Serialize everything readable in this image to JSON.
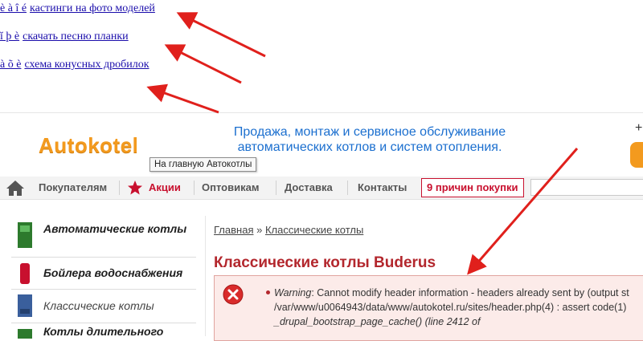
{
  "spam_links": [
    {
      "prefix": "è à î é",
      "text": "кастинги на фото моделей"
    },
    {
      "prefix": "ĭ þ è",
      "text": "скачать песню планки"
    },
    {
      "prefix": "à õ è",
      "text": "схема конусных дробилок"
    }
  ],
  "site": {
    "logo": "Autokotel",
    "logo_tooltip": "На главную Автокотлы",
    "slogan": "Продажа, монтаж и сервисное обслуживание автоматических котлов и систем отопления.",
    "header_right_plus": "+",
    "nav": {
      "items": [
        {
          "label": "Покупателям"
        },
        {
          "label": "Акции"
        },
        {
          "label": "Оптовикам"
        },
        {
          "label": "Доставка"
        },
        {
          "label": "Контакты"
        }
      ],
      "promo": "9 причин покупки"
    },
    "sidebar": {
      "items": [
        {
          "label": "Автоматические котлы"
        },
        {
          "label": "Бойлера водоснабжения"
        },
        {
          "label": "Классические котлы"
        },
        {
          "label": "Котлы длительного"
        }
      ]
    },
    "breadcrumb": {
      "home": "Главная",
      "sep": "»",
      "current": "Классические котлы"
    },
    "page_title": "Классические котлы Buderus",
    "warning": {
      "label": "Warning",
      "text": ": Cannot modify header information - headers already sent by (output st",
      "line2": "/var/www/u0064943/data/www/autokotel.ru/sites/header.php(4) : assert code(1)",
      "line3": "_drupal_bootstrap_page_cache() (line 2412 of"
    }
  },
  "colors": {
    "link": "#1a0dab",
    "logo": "#f39a1e",
    "slogan": "#1b6fcf",
    "accent_red": "#c8102e",
    "title": "#b3272d",
    "arrow": "#e0201c"
  }
}
